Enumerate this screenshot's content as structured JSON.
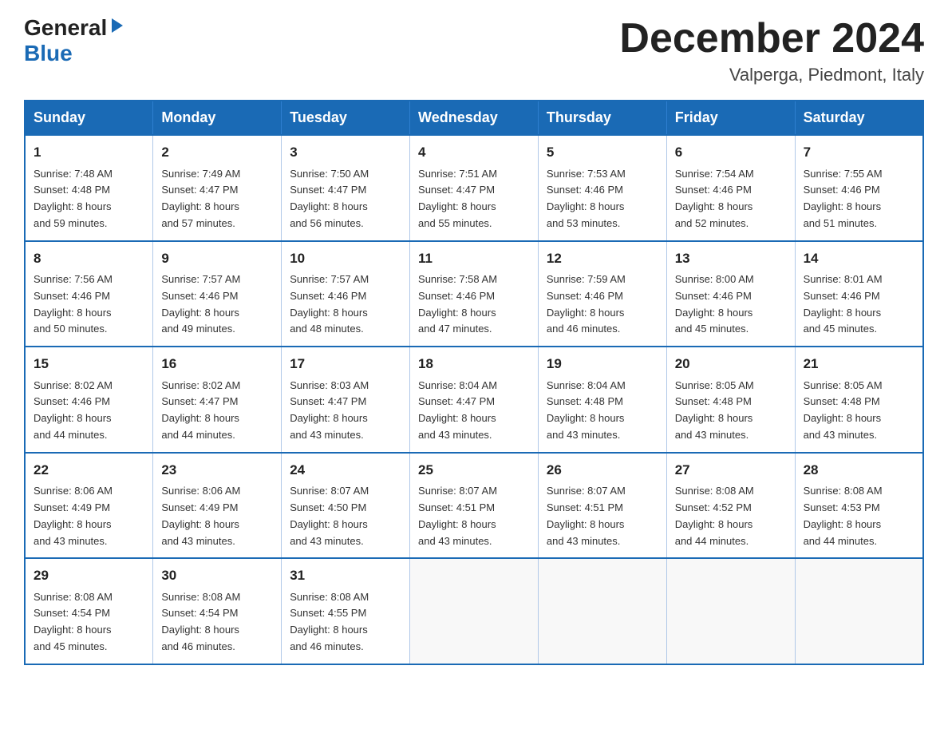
{
  "logo": {
    "line1": "General",
    "arrow": "▶",
    "line2": "Blue"
  },
  "header": {
    "month": "December 2024",
    "location": "Valperga, Piedmont, Italy"
  },
  "days_of_week": [
    "Sunday",
    "Monday",
    "Tuesday",
    "Wednesday",
    "Thursday",
    "Friday",
    "Saturday"
  ],
  "weeks": [
    [
      {
        "day": "1",
        "info": "Sunrise: 7:48 AM\nSunset: 4:48 PM\nDaylight: 8 hours\nand 59 minutes."
      },
      {
        "day": "2",
        "info": "Sunrise: 7:49 AM\nSunset: 4:47 PM\nDaylight: 8 hours\nand 57 minutes."
      },
      {
        "day": "3",
        "info": "Sunrise: 7:50 AM\nSunset: 4:47 PM\nDaylight: 8 hours\nand 56 minutes."
      },
      {
        "day": "4",
        "info": "Sunrise: 7:51 AM\nSunset: 4:47 PM\nDaylight: 8 hours\nand 55 minutes."
      },
      {
        "day": "5",
        "info": "Sunrise: 7:53 AM\nSunset: 4:46 PM\nDaylight: 8 hours\nand 53 minutes."
      },
      {
        "day": "6",
        "info": "Sunrise: 7:54 AM\nSunset: 4:46 PM\nDaylight: 8 hours\nand 52 minutes."
      },
      {
        "day": "7",
        "info": "Sunrise: 7:55 AM\nSunset: 4:46 PM\nDaylight: 8 hours\nand 51 minutes."
      }
    ],
    [
      {
        "day": "8",
        "info": "Sunrise: 7:56 AM\nSunset: 4:46 PM\nDaylight: 8 hours\nand 50 minutes."
      },
      {
        "day": "9",
        "info": "Sunrise: 7:57 AM\nSunset: 4:46 PM\nDaylight: 8 hours\nand 49 minutes."
      },
      {
        "day": "10",
        "info": "Sunrise: 7:57 AM\nSunset: 4:46 PM\nDaylight: 8 hours\nand 48 minutes."
      },
      {
        "day": "11",
        "info": "Sunrise: 7:58 AM\nSunset: 4:46 PM\nDaylight: 8 hours\nand 47 minutes."
      },
      {
        "day": "12",
        "info": "Sunrise: 7:59 AM\nSunset: 4:46 PM\nDaylight: 8 hours\nand 46 minutes."
      },
      {
        "day": "13",
        "info": "Sunrise: 8:00 AM\nSunset: 4:46 PM\nDaylight: 8 hours\nand 45 minutes."
      },
      {
        "day": "14",
        "info": "Sunrise: 8:01 AM\nSunset: 4:46 PM\nDaylight: 8 hours\nand 45 minutes."
      }
    ],
    [
      {
        "day": "15",
        "info": "Sunrise: 8:02 AM\nSunset: 4:46 PM\nDaylight: 8 hours\nand 44 minutes."
      },
      {
        "day": "16",
        "info": "Sunrise: 8:02 AM\nSunset: 4:47 PM\nDaylight: 8 hours\nand 44 minutes."
      },
      {
        "day": "17",
        "info": "Sunrise: 8:03 AM\nSunset: 4:47 PM\nDaylight: 8 hours\nand 43 minutes."
      },
      {
        "day": "18",
        "info": "Sunrise: 8:04 AM\nSunset: 4:47 PM\nDaylight: 8 hours\nand 43 minutes."
      },
      {
        "day": "19",
        "info": "Sunrise: 8:04 AM\nSunset: 4:48 PM\nDaylight: 8 hours\nand 43 minutes."
      },
      {
        "day": "20",
        "info": "Sunrise: 8:05 AM\nSunset: 4:48 PM\nDaylight: 8 hours\nand 43 minutes."
      },
      {
        "day": "21",
        "info": "Sunrise: 8:05 AM\nSunset: 4:48 PM\nDaylight: 8 hours\nand 43 minutes."
      }
    ],
    [
      {
        "day": "22",
        "info": "Sunrise: 8:06 AM\nSunset: 4:49 PM\nDaylight: 8 hours\nand 43 minutes."
      },
      {
        "day": "23",
        "info": "Sunrise: 8:06 AM\nSunset: 4:49 PM\nDaylight: 8 hours\nand 43 minutes."
      },
      {
        "day": "24",
        "info": "Sunrise: 8:07 AM\nSunset: 4:50 PM\nDaylight: 8 hours\nand 43 minutes."
      },
      {
        "day": "25",
        "info": "Sunrise: 8:07 AM\nSunset: 4:51 PM\nDaylight: 8 hours\nand 43 minutes."
      },
      {
        "day": "26",
        "info": "Sunrise: 8:07 AM\nSunset: 4:51 PM\nDaylight: 8 hours\nand 43 minutes."
      },
      {
        "day": "27",
        "info": "Sunrise: 8:08 AM\nSunset: 4:52 PM\nDaylight: 8 hours\nand 44 minutes."
      },
      {
        "day": "28",
        "info": "Sunrise: 8:08 AM\nSunset: 4:53 PM\nDaylight: 8 hours\nand 44 minutes."
      }
    ],
    [
      {
        "day": "29",
        "info": "Sunrise: 8:08 AM\nSunset: 4:54 PM\nDaylight: 8 hours\nand 45 minutes."
      },
      {
        "day": "30",
        "info": "Sunrise: 8:08 AM\nSunset: 4:54 PM\nDaylight: 8 hours\nand 46 minutes."
      },
      {
        "day": "31",
        "info": "Sunrise: 8:08 AM\nSunset: 4:55 PM\nDaylight: 8 hours\nand 46 minutes."
      },
      {
        "day": "",
        "info": ""
      },
      {
        "day": "",
        "info": ""
      },
      {
        "day": "",
        "info": ""
      },
      {
        "day": "",
        "info": ""
      }
    ]
  ]
}
